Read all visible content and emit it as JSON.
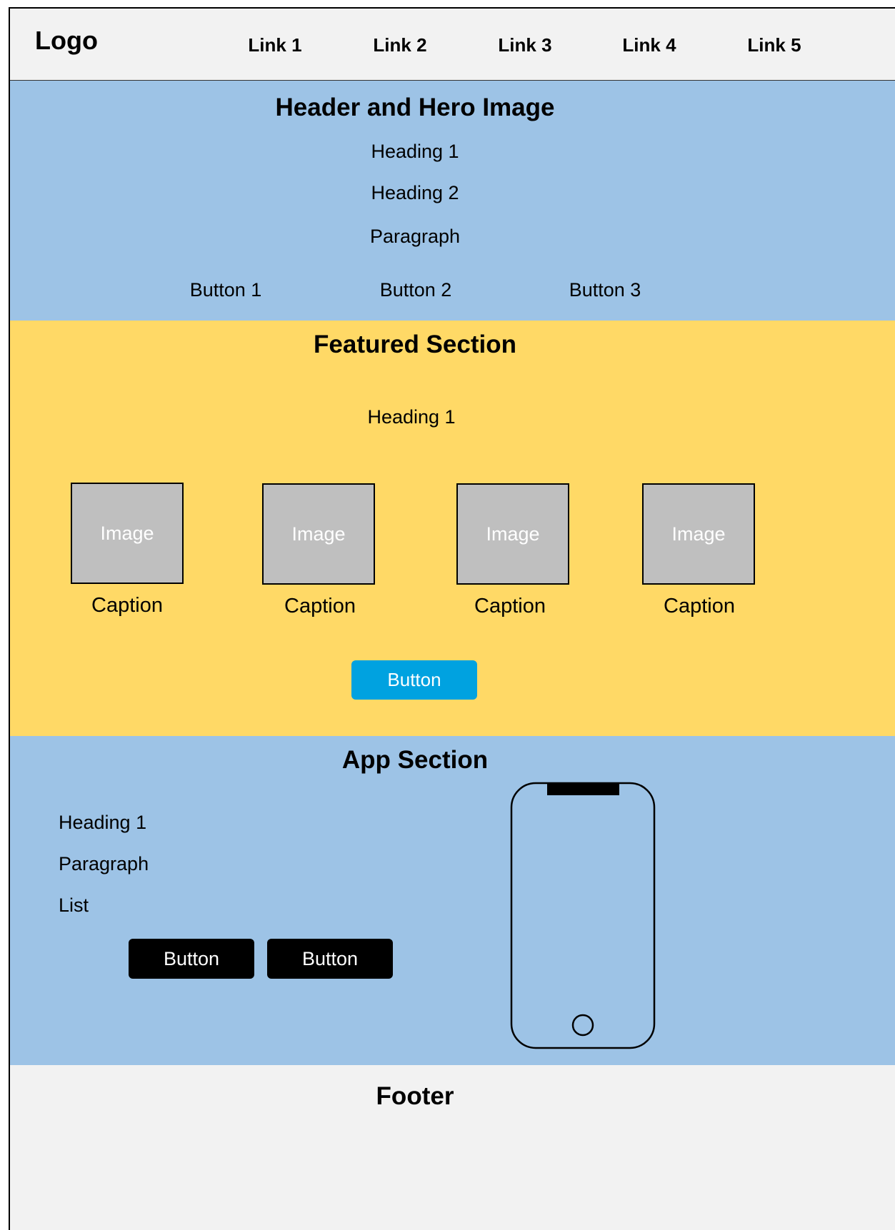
{
  "nav": {
    "logo": "Logo",
    "links": [
      "Link 1",
      "Link 2",
      "Link 3",
      "Link 4",
      "Link 5"
    ]
  },
  "hero": {
    "title": "Header and Hero Image",
    "heading1": "Heading 1",
    "heading2": "Heading 2",
    "paragraph": "Paragraph",
    "buttons": [
      "Button 1",
      "Button 2",
      "Button 3"
    ],
    "background": "#9dc3e6"
  },
  "featured": {
    "title": "Featured Section",
    "heading1": "Heading 1",
    "items": [
      {
        "image_label": "Image",
        "caption": "Caption"
      },
      {
        "image_label": "Image",
        "caption": "Caption"
      },
      {
        "image_label": "Image",
        "caption": "Caption"
      },
      {
        "image_label": "Image",
        "caption": "Caption"
      }
    ],
    "button": "Button",
    "background": "#ffd966",
    "button_color": "#00a2e0"
  },
  "app": {
    "title": "App Section",
    "heading1": "Heading 1",
    "paragraph": "Paragraph",
    "list": "List",
    "buttons": [
      "Button",
      "Button"
    ],
    "phone_icon": "smartphone-icon",
    "background": "#9dc3e6"
  },
  "footer": {
    "title": "Footer",
    "background": "#f2f2f2"
  }
}
